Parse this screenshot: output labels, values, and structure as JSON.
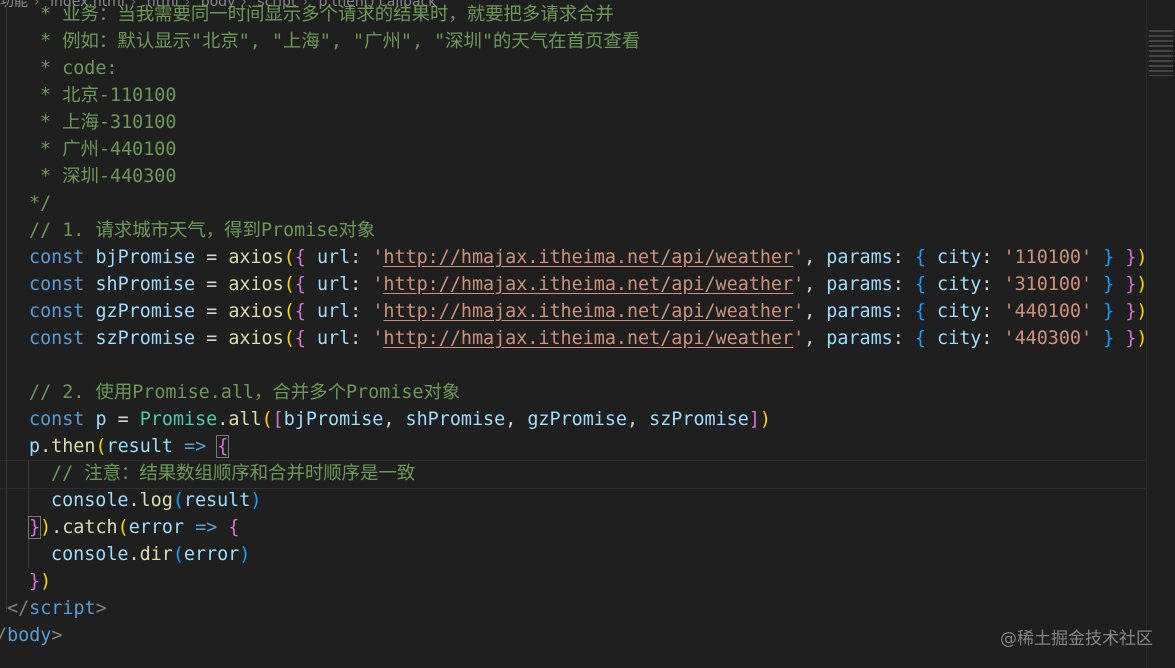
{
  "breadcrumb": {
    "items": [
      "功能",
      "index.html",
      "html",
      "body",
      "script",
      "p.then() callback"
    ]
  },
  "code": {
    "l01": "* 业务：当我需要同一时间显示多个请求的结果时，就要把多请求合并",
    "l02": "* 例如：默认显示\"北京\", \"上海\", \"广州\", \"深圳\"的天气在首页查看",
    "l03": "* code:",
    "l04": "* 北京-110100",
    "l05": "* 上海-310100",
    "l06": "* 广州-440100",
    "l07": "* 深圳-440300",
    "l08": "*/",
    "l09": "// 1. 请求城市天气，得到Promise对象",
    "kw_const": "const",
    "kw_params": "params",
    "kw_city": "city",
    "kw_url": "url",
    "fn_axios": "axios",
    "url": "http://hmajax.itheima.net/api/weather",
    "vars": [
      "bjPromise",
      "shPromise",
      "gzPromise",
      "szPromise"
    ],
    "codes": [
      "'110100'",
      "'310100'",
      "'440100'",
      "'440300'"
    ],
    "l15": "// 2. 使用Promise.all，合并多个Promise对象",
    "var_p": "p",
    "cls_promise": "Promise",
    "fn_all": "all",
    "fn_then": "then",
    "arg_result": "result",
    "l18": "// 注意：结果数组顺序和合并时顺序是一致",
    "obj_console": "console",
    "fn_log": "log",
    "fn_catch": "catch",
    "arg_error": "error",
    "fn_dir": "dir",
    "tag_script": "script",
    "tag_body": "body"
  },
  "watermark": "@稀土掘金技术社区"
}
